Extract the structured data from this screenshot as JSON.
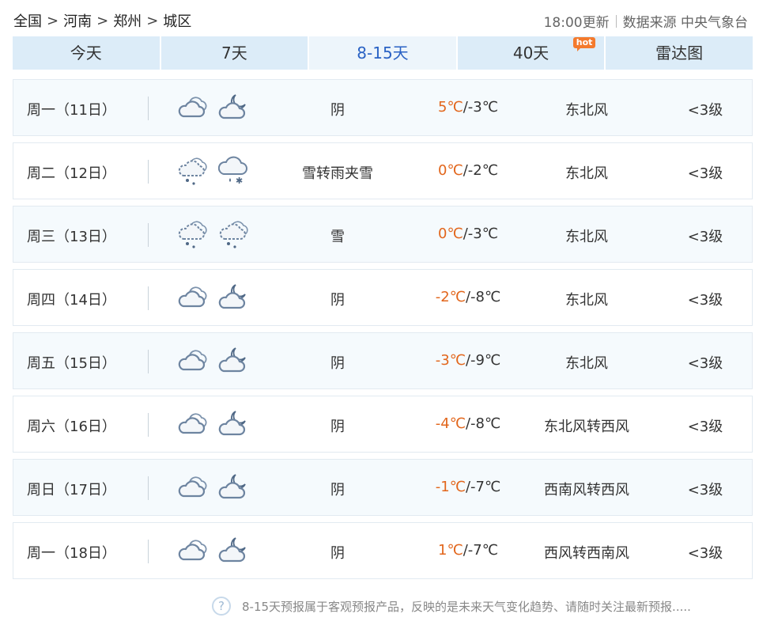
{
  "breadcrumb": {
    "items": [
      "全国",
      "河南",
      "郑州",
      "城区"
    ],
    "separator": ">"
  },
  "meta": {
    "update_time": "18:00更新",
    "source": "数据来源 中央气象台"
  },
  "tabs": [
    {
      "label": "今天",
      "active": false
    },
    {
      "label": "7天",
      "active": false
    },
    {
      "label": "8-15天",
      "active": true
    },
    {
      "label": "40天",
      "active": false,
      "badge": "hot"
    },
    {
      "label": "雷达图",
      "active": false
    }
  ],
  "colors": {
    "tab_bg": "#dcecf8",
    "tab_active_text": "#2a62c4",
    "high_temp": "#e2661c",
    "hot_badge": "#f47a2d"
  },
  "forecast": [
    {
      "day": "周一（11日）",
      "icon_day": "cloudy-icon",
      "icon_night": "night-cloud-icon",
      "desc": "阴",
      "high": "5℃",
      "low": "-3℃",
      "wind": "东北风",
      "level": "<3级"
    },
    {
      "day": "周二（12日）",
      "icon_day": "snow-icon",
      "icon_night": "sleet-icon",
      "desc": "雪转雨夹雪",
      "high": "0℃",
      "low": "-2℃",
      "wind": "东北风",
      "level": "<3级"
    },
    {
      "day": "周三（13日）",
      "icon_day": "snow-icon",
      "icon_night": "snow-icon",
      "desc": "雪",
      "high": "0℃",
      "low": "-3℃",
      "wind": "东北风",
      "level": "<3级"
    },
    {
      "day": "周四（14日）",
      "icon_day": "cloudy-icon",
      "icon_night": "night-cloud-icon",
      "desc": "阴",
      "high": "-2℃",
      "low": "-8℃",
      "wind": "东北风",
      "level": "<3级"
    },
    {
      "day": "周五（15日）",
      "icon_day": "cloudy-icon",
      "icon_night": "night-cloud-icon",
      "desc": "阴",
      "high": "-3℃",
      "low": "-9℃",
      "wind": "东北风",
      "level": "<3级"
    },
    {
      "day": "周六（16日）",
      "icon_day": "cloudy-icon",
      "icon_night": "night-cloud-icon",
      "desc": "阴",
      "high": "-4℃",
      "low": "-8℃",
      "wind": "东北风转西风",
      "level": "<3级"
    },
    {
      "day": "周日（17日）",
      "icon_day": "cloudy-icon",
      "icon_night": "night-cloud-icon",
      "desc": "阴",
      "high": "-1℃",
      "low": "-7℃",
      "wind": "西南风转西风",
      "level": "<3级"
    },
    {
      "day": "周一（18日）",
      "icon_day": "cloudy-icon",
      "icon_night": "night-cloud-icon",
      "desc": "阴",
      "high": "1℃",
      "low": "-7℃",
      "wind": "西风转西南风",
      "level": "<3级"
    }
  ],
  "footer": {
    "help_glyph": "?",
    "note": "8-15天预报属于客观预报产品，反映的是未来天气变化趋势、请随时关注最新预报....."
  }
}
